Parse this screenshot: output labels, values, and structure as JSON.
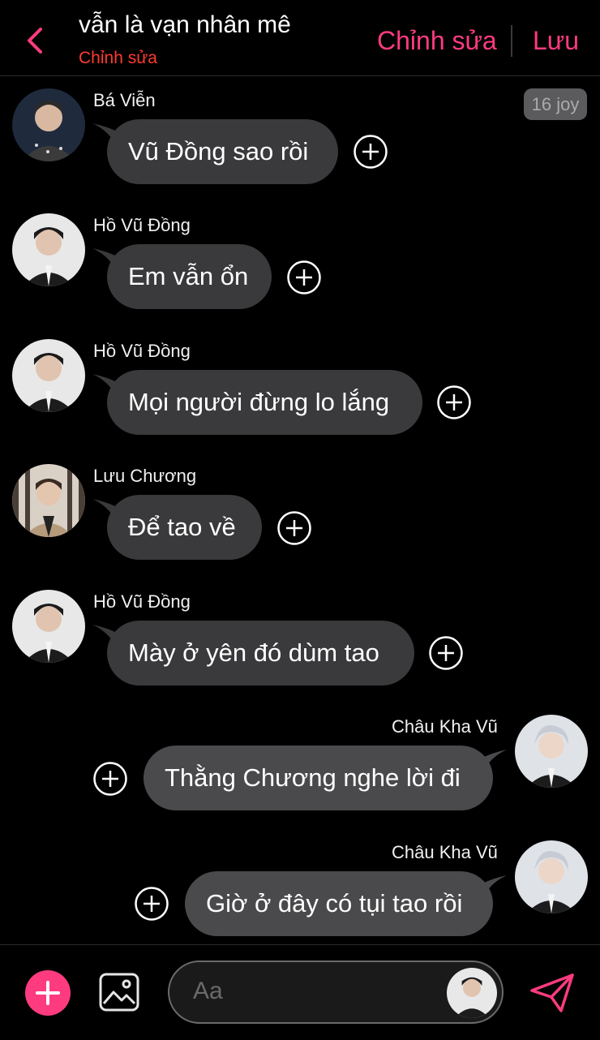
{
  "header": {
    "title": "vẫn là vạn nhân mê",
    "subtitle": "Chỉnh sửa",
    "edit_label": "Chỉnh sửa",
    "save_label": "Lưu",
    "back_icon": "chevron-left-icon"
  },
  "timestamp_badge": "16 joy",
  "messages": [
    {
      "side": "left",
      "sender": "Bá Viễn",
      "text": "Vũ Đồng sao rồi",
      "avatar": "ba-vien-avatar"
    },
    {
      "side": "left",
      "sender": "Hồ Vũ Đồng",
      "text": "Em vẫn ổn",
      "avatar": "ho-vu-dong-avatar"
    },
    {
      "side": "left",
      "sender": "Hồ Vũ Đồng",
      "text": "Mọi người đừng lo lắng",
      "avatar": "ho-vu-dong-avatar"
    },
    {
      "side": "left",
      "sender": "Lưu Chương",
      "text": "Để tao về",
      "avatar": "luu-chuong-avatar"
    },
    {
      "side": "left",
      "sender": "Hồ Vũ Đồng",
      "text": "Mày ở yên đó dùm tao",
      "avatar": "ho-vu-dong-avatar"
    },
    {
      "side": "right",
      "sender": "Châu Kha Vũ",
      "text": "Thằng Chương nghe lời đi",
      "avatar": "chau-kha-vu-avatar"
    },
    {
      "side": "right",
      "sender": "Châu Kha Vũ",
      "text": "Giờ ở đây có tụi tao rồi",
      "avatar": "chau-kha-vu-avatar"
    }
  ],
  "composer": {
    "placeholder": "Aa",
    "add_icon": "plus-icon",
    "image_icon": "image-icon",
    "send_icon": "send-icon"
  },
  "colors": {
    "accent": "#ff3b80",
    "subtitle": "#ff3b30",
    "bubble_left": "#3a3a3c",
    "bubble_right": "#4a4a4c",
    "background": "#000000"
  }
}
